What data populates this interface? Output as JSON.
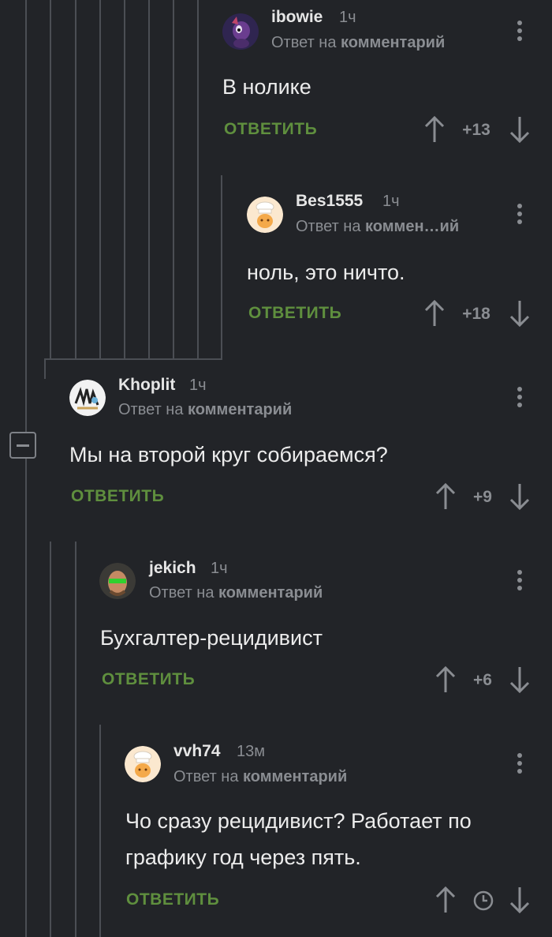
{
  "ui": {
    "reply_label": "ОТВЕТИТЬ",
    "reply_prefix": "Ответ на",
    "collapse_icon": "minus-icon",
    "colors": {
      "background": "#222428",
      "reply": "#5f8f3e",
      "muted": "#8a8d92",
      "thread_line": "#4b4e54"
    }
  },
  "comments": [
    {
      "author": "ibowie",
      "time": "1ч",
      "reply_target": "комментарий",
      "text": "В нолике",
      "rating": "+13"
    },
    {
      "author": "Bes1555",
      "time": "1ч",
      "reply_target": "коммен…ий",
      "text": "ноль, это ничто.",
      "rating": "+18"
    },
    {
      "author": "Khoplit",
      "time": "1ч",
      "reply_target": "комментарий",
      "text": "Мы на второй круг собираемся?",
      "rating": "+9"
    },
    {
      "author": "jekich",
      "time": "1ч",
      "reply_target": "комментарий",
      "text": "Бухгалтер-рецидивист",
      "rating": "+6"
    },
    {
      "author": "vvh74",
      "time": "13м",
      "reply_target": "комментарий",
      "text_line1": "Чо сразу рецидивист? Работает по",
      "text_line2": "графику год через пять.",
      "rating_icon": "clock-icon"
    }
  ]
}
